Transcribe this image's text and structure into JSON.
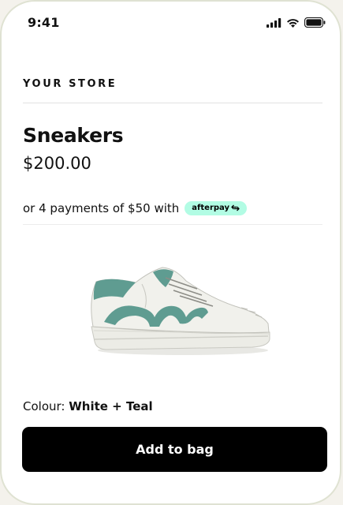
{
  "status_bar": {
    "time": "9:41",
    "icons": [
      "cellular-signal-icon",
      "wifi-icon",
      "battery-icon"
    ]
  },
  "store": {
    "name": "YOUR STORE"
  },
  "product": {
    "title": "Sneakers",
    "price": "$200.00",
    "image_icon": "sneaker-image",
    "colour_label": "Colour:",
    "colour_value": "White + Teal"
  },
  "payment": {
    "installment_text": "or 4 payments of $50 with",
    "provider_label": "afterpay",
    "provider_icon": "afterpay-arrows-icon",
    "badge_color": "#b2fce4"
  },
  "actions": {
    "add_to_bag_label": "Add to bag",
    "button_color": "#000000"
  }
}
